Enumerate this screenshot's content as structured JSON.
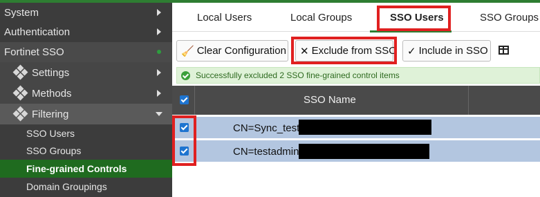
{
  "sidebar": {
    "top_items": [
      {
        "label": "System"
      },
      {
        "label": "Authentication"
      }
    ],
    "section": {
      "label": "Fortinet SSO"
    },
    "sub_items": [
      {
        "label": "Settings"
      },
      {
        "label": "Methods"
      },
      {
        "label": "Filtering"
      }
    ],
    "filtering_items": [
      {
        "label": "SSO Users"
      },
      {
        "label": "SSO Groups"
      },
      {
        "label": "Fine-grained Controls",
        "selected": true
      },
      {
        "label": "Domain Groupings"
      }
    ]
  },
  "tabs": [
    {
      "label": "Local Users"
    },
    {
      "label": "Local Groups"
    },
    {
      "label": "SSO Users",
      "active": true
    },
    {
      "label": "SSO Groups"
    }
  ],
  "toolbar": {
    "clear_label": "Clear Configuration",
    "exclude_label": "Exclude from SSO",
    "include_label": "Include in SSO"
  },
  "banner": {
    "text": "Successfully excluded 2 SSO fine-grained control items"
  },
  "table": {
    "columns": [
      "SSO Name"
    ],
    "rows": [
      {
        "name": "CN=Sync_test",
        "checked": true
      },
      {
        "name": "CN=testadmin",
        "checked": true
      }
    ]
  },
  "colors": {
    "accent": "#2e7d32",
    "highlight": "#e02020",
    "row_selected": "#b3c6e0",
    "checkbox": "#1e74d0"
  },
  "icons": {
    "menu_item": "cog-icon",
    "clear": "broom-icon",
    "exclude": "x-icon",
    "include": "check-icon",
    "columns": "column-settings-icon",
    "banner": "success-check-icon"
  }
}
